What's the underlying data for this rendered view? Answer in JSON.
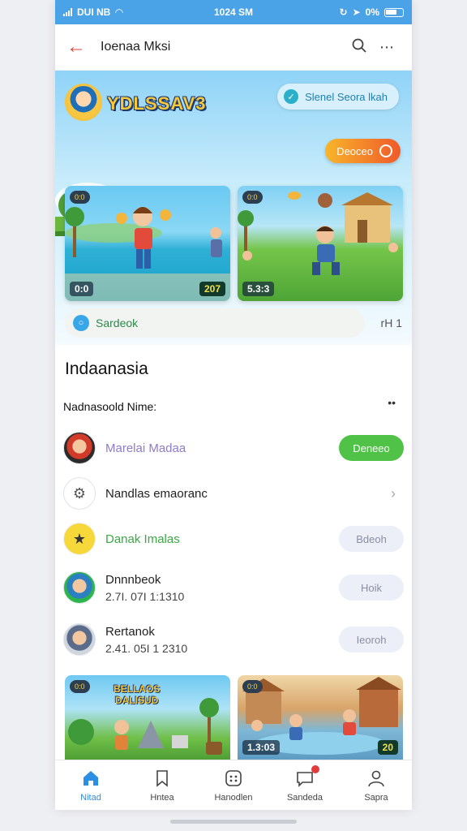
{
  "status_bar": {
    "left_text": "DUI NB",
    "time": "1024 SM",
    "right_text": "0%"
  },
  "header": {
    "title": "Ioenaa Mksi"
  },
  "hero": {
    "title": "YDLSSAV3",
    "pill_label": "Slenel Seora lkah",
    "cta_label": "Deoceo",
    "cards": [
      {
        "badge": "0:0",
        "score": "207",
        "score_left": "0:0"
      },
      {
        "badge": "0:0",
        "score": "5.3:3"
      }
    ],
    "search_placeholder": "Sardeok",
    "search_count": "rH 1"
  },
  "section": {
    "title": "Indaanasia",
    "subtitle": "Nadnasoold Nime:",
    "more": "••"
  },
  "list": [
    {
      "name": "Marelai Madaa",
      "meta": "",
      "button": "Deneeo",
      "button_style": "green",
      "name_color": "#8f7bc9"
    },
    {
      "name": "Nandlas emaoranc",
      "meta": "",
      "button": "",
      "button_style": "chevron",
      "name_color": "#222222"
    },
    {
      "name": "Danak Imalas",
      "meta": "",
      "button": "Bdeoh",
      "button_style": "soft",
      "name_color": "#3aa845"
    },
    {
      "name": "Dnnnbeok",
      "meta": "2.7I. 07I 1:1310",
      "button": "Hoik",
      "button_style": "soft",
      "name_color": "#222222"
    },
    {
      "name": "Rertanok",
      "meta": "2.41. 05I 1 2310",
      "button": "Ieoroh",
      "button_style": "soft",
      "name_color": "#222222"
    }
  ],
  "bottom_cards": [
    {
      "badge": "0:0",
      "banner": "BELLAOS\nDALISUD"
    },
    {
      "badge": "0:0",
      "score": "1.3:03"
    }
  ],
  "bottom_cards_extra": {
    "right_score": "20"
  },
  "tabbar": [
    {
      "label": "Nitad",
      "icon": "home-icon",
      "active": true
    },
    {
      "label": "Hntea",
      "icon": "bookmark-icon",
      "active": false
    },
    {
      "label": "Hanodlen",
      "icon": "apps-icon",
      "active": false
    },
    {
      "label": "Sandeda",
      "icon": "message-icon",
      "active": false
    },
    {
      "label": "Sapra",
      "icon": "person-icon",
      "active": false
    }
  ],
  "colors": {
    "accent": "#2d8fe3",
    "status_bar": "#4aa3e6",
    "green_button": "#4fc247",
    "soft_button": "#eceef8",
    "back_arrow": "#e2413b"
  }
}
